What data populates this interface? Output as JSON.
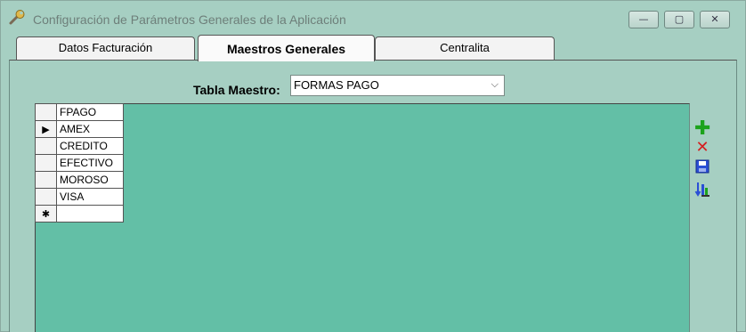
{
  "window": {
    "title": "Configuración de Parámetros Generales de la Aplicación",
    "controls": {
      "minimize": "—",
      "maximize": "▢",
      "close": "✕"
    }
  },
  "tabs": [
    {
      "label": "Datos Facturación",
      "selected": false
    },
    {
      "label": "Maestros Generales",
      "selected": true
    },
    {
      "label": "Centralita",
      "selected": false
    }
  ],
  "tabla_maestro": {
    "label": "Tabla Maestro:",
    "value": "FORMAS PAGO"
  },
  "grid": {
    "header": "FPAGO",
    "rows": [
      "AMEX",
      "CREDITO",
      "EFECTIVO",
      "MOROSO",
      "VISA"
    ],
    "current_row_marker": "▶",
    "new_row_marker": "✱"
  },
  "toolbar": {
    "add_icon": "plus-icon",
    "delete_icon": "delete-icon",
    "save_icon": "save-icon",
    "sort_icon": "sort-icon",
    "add_color": "#1ca31c",
    "delete_color": "#d42020"
  },
  "colors": {
    "window_bg": "#a6cfc2",
    "grid_bg": "#63bfa6"
  }
}
